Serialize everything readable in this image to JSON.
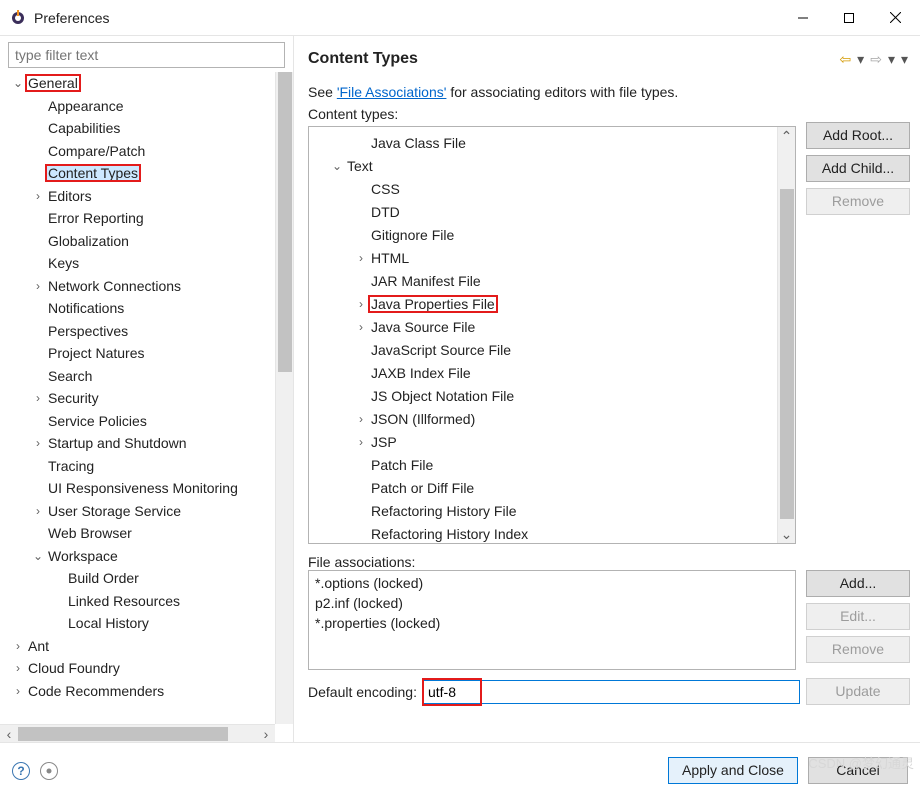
{
  "window": {
    "title": "Preferences"
  },
  "filter": {
    "placeholder": "type filter text"
  },
  "sidebar": {
    "rows": [
      {
        "indent": 0,
        "tw": "⌄",
        "label": "General",
        "hl": true
      },
      {
        "indent": 1,
        "tw": "",
        "label": "Appearance"
      },
      {
        "indent": 1,
        "tw": "",
        "label": "Capabilities"
      },
      {
        "indent": 1,
        "tw": "",
        "label": "Compare/Patch"
      },
      {
        "indent": 1,
        "tw": "",
        "label": "Content Types",
        "sel": true,
        "hl": true
      },
      {
        "indent": 1,
        "tw": "›",
        "label": "Editors"
      },
      {
        "indent": 1,
        "tw": "",
        "label": "Error Reporting"
      },
      {
        "indent": 1,
        "tw": "",
        "label": "Globalization"
      },
      {
        "indent": 1,
        "tw": "",
        "label": "Keys"
      },
      {
        "indent": 1,
        "tw": "›",
        "label": "Network Connections"
      },
      {
        "indent": 1,
        "tw": "",
        "label": "Notifications"
      },
      {
        "indent": 1,
        "tw": "",
        "label": "Perspectives"
      },
      {
        "indent": 1,
        "tw": "",
        "label": "Project Natures"
      },
      {
        "indent": 1,
        "tw": "",
        "label": "Search"
      },
      {
        "indent": 1,
        "tw": "›",
        "label": "Security"
      },
      {
        "indent": 1,
        "tw": "",
        "label": "Service Policies"
      },
      {
        "indent": 1,
        "tw": "›",
        "label": "Startup and Shutdown"
      },
      {
        "indent": 1,
        "tw": "",
        "label": "Tracing"
      },
      {
        "indent": 1,
        "tw": "",
        "label": "UI Responsiveness Monitoring"
      },
      {
        "indent": 1,
        "tw": "›",
        "label": "User Storage Service"
      },
      {
        "indent": 1,
        "tw": "",
        "label": "Web Browser"
      },
      {
        "indent": 1,
        "tw": "⌄",
        "label": "Workspace"
      },
      {
        "indent": 2,
        "tw": "",
        "label": "Build Order"
      },
      {
        "indent": 2,
        "tw": "",
        "label": "Linked Resources"
      },
      {
        "indent": 2,
        "tw": "",
        "label": "Local History"
      },
      {
        "indent": 0,
        "tw": "›",
        "label": "Ant"
      },
      {
        "indent": 0,
        "tw": "›",
        "label": "Cloud Foundry"
      },
      {
        "indent": 0,
        "tw": "›",
        "label": "Code Recommenders"
      }
    ]
  },
  "page": {
    "heading": "Content Types",
    "intro_pre": "See ",
    "intro_link": "'File Associations'",
    "intro_post": " for associating editors with file types.",
    "ct_label": "Content types:",
    "fa_label": "File associations:",
    "enc_label": "Default encoding:",
    "enc_value": "utf-8"
  },
  "content_types": {
    "rows": [
      {
        "indent": 1,
        "tw": "",
        "label": "Java Class File"
      },
      {
        "indent": 0,
        "tw": "⌄",
        "label": "Text"
      },
      {
        "indent": 1,
        "tw": "",
        "label": "CSS"
      },
      {
        "indent": 1,
        "tw": "",
        "label": "DTD"
      },
      {
        "indent": 1,
        "tw": "",
        "label": "Gitignore File"
      },
      {
        "indent": 1,
        "tw": "›",
        "label": "HTML"
      },
      {
        "indent": 1,
        "tw": "",
        "label": "JAR Manifest File"
      },
      {
        "indent": 1,
        "tw": "›",
        "label": "Java Properties File",
        "hl": true
      },
      {
        "indent": 1,
        "tw": "›",
        "label": "Java Source File"
      },
      {
        "indent": 1,
        "tw": "",
        "label": "JavaScript Source File"
      },
      {
        "indent": 1,
        "tw": "",
        "label": "JAXB Index File"
      },
      {
        "indent": 1,
        "tw": "",
        "label": "JS Object Notation File"
      },
      {
        "indent": 1,
        "tw": "›",
        "label": "JSON (Illformed)"
      },
      {
        "indent": 1,
        "tw": "›",
        "label": "JSP"
      },
      {
        "indent": 1,
        "tw": "",
        "label": "Patch File"
      },
      {
        "indent": 1,
        "tw": "",
        "label": "Patch or Diff File"
      },
      {
        "indent": 1,
        "tw": "",
        "label": "Refactoring History File"
      },
      {
        "indent": 1,
        "tw": "",
        "label": "Refactoring History Index"
      }
    ]
  },
  "file_assoc": [
    "*.options (locked)",
    "p2.inf (locked)",
    "*.properties (locked)"
  ],
  "buttons": {
    "add_root": "Add Root...",
    "add_child": "Add Child...",
    "remove_ct": "Remove",
    "add": "Add...",
    "edit": "Edit...",
    "remove_fa": "Remove",
    "update": "Update",
    "apply": "Apply and Close",
    "cancel": "Cancel"
  },
  "watermark": "CSDN @梦幻通灵"
}
